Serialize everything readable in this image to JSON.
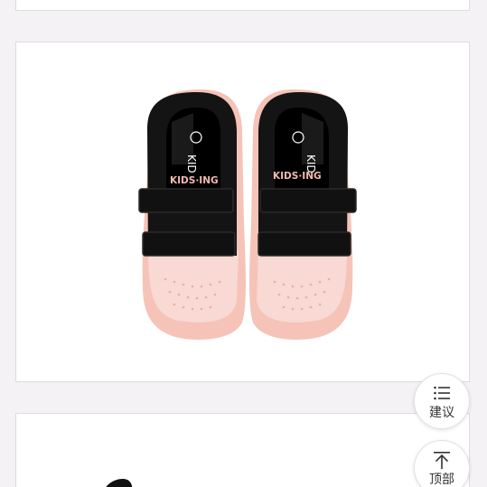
{
  "product_images": {
    "main": {
      "brand_text": "KIDS·ING",
      "tongue_text": "KID",
      "colors": {
        "upper": "#141414",
        "toe": "#f8d9d3",
        "sole": "#f6c3b8",
        "brand": "#f2b9ad"
      }
    },
    "bottom_preview": {
      "color": "#111111"
    }
  },
  "floating_buttons": {
    "suggest": {
      "label": "建议",
      "icon": "list-icon"
    },
    "back_to_top": {
      "label": "顶部",
      "icon": "arrow-up-icon"
    }
  }
}
